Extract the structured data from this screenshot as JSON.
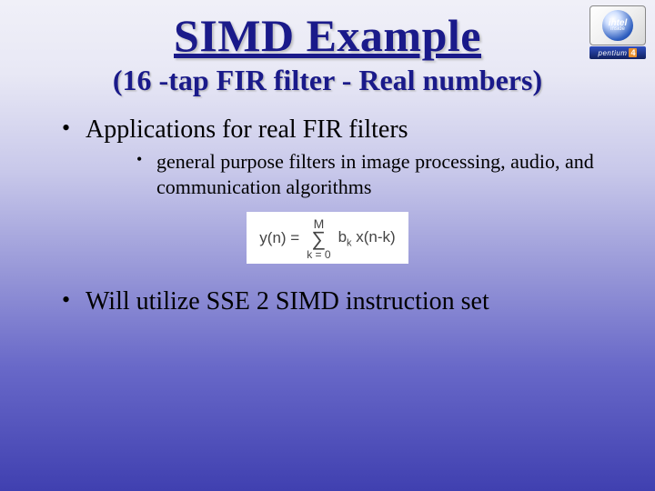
{
  "title": "SIMD Example",
  "subtitle": "(16 -tap FIR filter - Real numbers)",
  "bullets": {
    "b1": "Applications for real FIR filters",
    "b1a": "general purpose filters in image processing, audio, and communication algorithms",
    "b2": "Will utilize SSE 2 SIMD instruction set"
  },
  "formula": {
    "lhs": "y(n) =",
    "sigma_top": "M",
    "sigma": "∑",
    "sigma_bottom": "k = 0",
    "rhs_b": "b",
    "rhs_k": "k",
    "rhs_x": " x(n-k)"
  },
  "logo": {
    "intel": "intel",
    "inside": "inside",
    "pentium": "pentium",
    "four": "4"
  }
}
